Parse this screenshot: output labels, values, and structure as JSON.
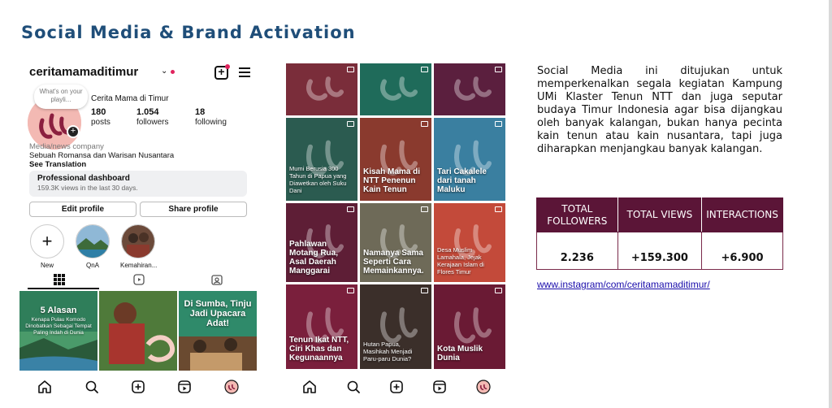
{
  "slide": {
    "title": "Social Media & Brand Activation"
  },
  "profile": {
    "username": "ceritamamaditimur",
    "note_bubble": "What's on your playli...",
    "display_name": "Cerita Mama di Timur",
    "stats": [
      {
        "value": "180",
        "label": "posts"
      },
      {
        "value": "1.054",
        "label": "followers"
      },
      {
        "value": "18",
        "label": "following"
      }
    ],
    "category": "Media/news company",
    "bio": "Sebuah Romansa dan Warisan Nusantara",
    "see_translation": "See Translation",
    "pro_dashboard_title": "Professional dashboard",
    "pro_dashboard_sub": "159.3K views in the last 30 days.",
    "edit_profile": "Edit profile",
    "share_profile": "Share profile",
    "highlights": [
      {
        "label": "New",
        "icon": "plus-icon"
      },
      {
        "label": "QnA",
        "icon": "landscape-thumb"
      },
      {
        "label": "Kemahiran...",
        "icon": "people-thumb"
      }
    ],
    "grid_posts": [
      {
        "caption": "5 Alasan",
        "sub": "Kenapa Pulau Komodo Dinobatkan Sebagai Tempat Paling Indah di Dunia"
      },
      {
        "caption": "",
        "sub": ""
      },
      {
        "caption": "Di Sumba, Tinju Jadi Upacara Adat!",
        "sub": ""
      }
    ]
  },
  "feed": {
    "posts": [
      {
        "caption": "",
        "color": "#7a2d3a"
      },
      {
        "caption": "",
        "color": "#1f6b5a"
      },
      {
        "caption": "",
        "color": "#5b1f3e"
      },
      {
        "caption": "Mumi Berusia 300 Tahun di Papua yang Diawetkan oleh Suku Dani",
        "color": "#2b5b50"
      },
      {
        "caption": "Kisah Mama di NTT Penenun Kain Tenun",
        "color": "#8a3a2e"
      },
      {
        "caption": "Tari Cakalele dari tanah Maluku",
        "color": "#3a7fa0"
      },
      {
        "caption": "Pahlawan Motang Rua, Asal Daerah Manggarai",
        "color": "#5e1e36"
      },
      {
        "caption": "Namanya Sama Seperti Cara Memainkannya.",
        "color": "#6e6a58"
      },
      {
        "caption": "Desa Muslim Lamahala, Jejak Kerajaan Islam di Flores Timur",
        "color": "#c34a3a"
      },
      {
        "caption": "Tenun Ikat NTT, Ciri Khas dan Kegunaannya",
        "color": "#7a1f3c"
      },
      {
        "caption": "Hutan Papua, Masihkah Menjadi Paru-paru Dunia?",
        "color": "#3b2f2a"
      },
      {
        "caption": "Kota Muslik Dunia",
        "color": "#6a1a34"
      }
    ]
  },
  "description": "Social Media ini ditujukan untuk memperkenalkan segala kegiatan Kampung UMi Klaster Tenun NTT dan juga seputar budaya Timur Indonesia agar bisa dijangkau oleh banyak kalangan, bukan hanya pecinta kain tenun atau kain nusantara, tapi juga diharapkan menjangkau banyak kalangan.",
  "table": {
    "headers": [
      "TOTAL FOLLOWERS",
      "TOTAL VIEWS",
      "INTERACTIONS"
    ],
    "values": [
      "2.236",
      "+159.300",
      "+6.900"
    ]
  },
  "link": "www.instagram/com/ceritamamaditimur/",
  "colors": {
    "title": "#1f4e79",
    "table_header": "#5b1537",
    "brand_pink": "#e0245e"
  }
}
